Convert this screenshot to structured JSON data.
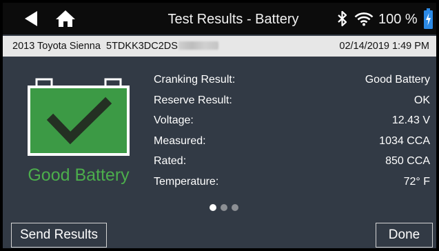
{
  "status_bar": {
    "title": "Test Results - Battery",
    "battery_percent": "100 %",
    "icons": [
      "back-arrow-icon",
      "home-icon",
      "bluetooth-icon",
      "wifi-icon",
      "battery-charging-icon"
    ]
  },
  "vehicle_bar": {
    "vehicle": "2013 Toyota Sienna",
    "vin_visible": "5TDKK3DC2DS",
    "datetime": "02/14/2019 1:49 PM"
  },
  "battery_panel": {
    "status_text": "Good Battery",
    "status_color": "#4cae4c",
    "icon": "battery-check-icon"
  },
  "results": [
    {
      "label": "Cranking Result:",
      "value": "Good Battery"
    },
    {
      "label": "Reserve Result:",
      "value": "OK"
    },
    {
      "label": "Voltage:",
      "value": "12.43 V"
    },
    {
      "label": "Measured:",
      "value": "1034 CCA"
    },
    {
      "label": "Rated:",
      "value": "850 CCA"
    },
    {
      "label": "Temperature:",
      "value": "72° F"
    }
  ],
  "pager": {
    "current_page": 1,
    "total_pages": 3
  },
  "buttons": {
    "send": "Send Results",
    "done": "Done"
  },
  "colors": {
    "accent_green": "#4cae4c",
    "battery_fill": "#3c9a45",
    "background": "#323a45",
    "charging_blue": "#2c8ae6"
  }
}
